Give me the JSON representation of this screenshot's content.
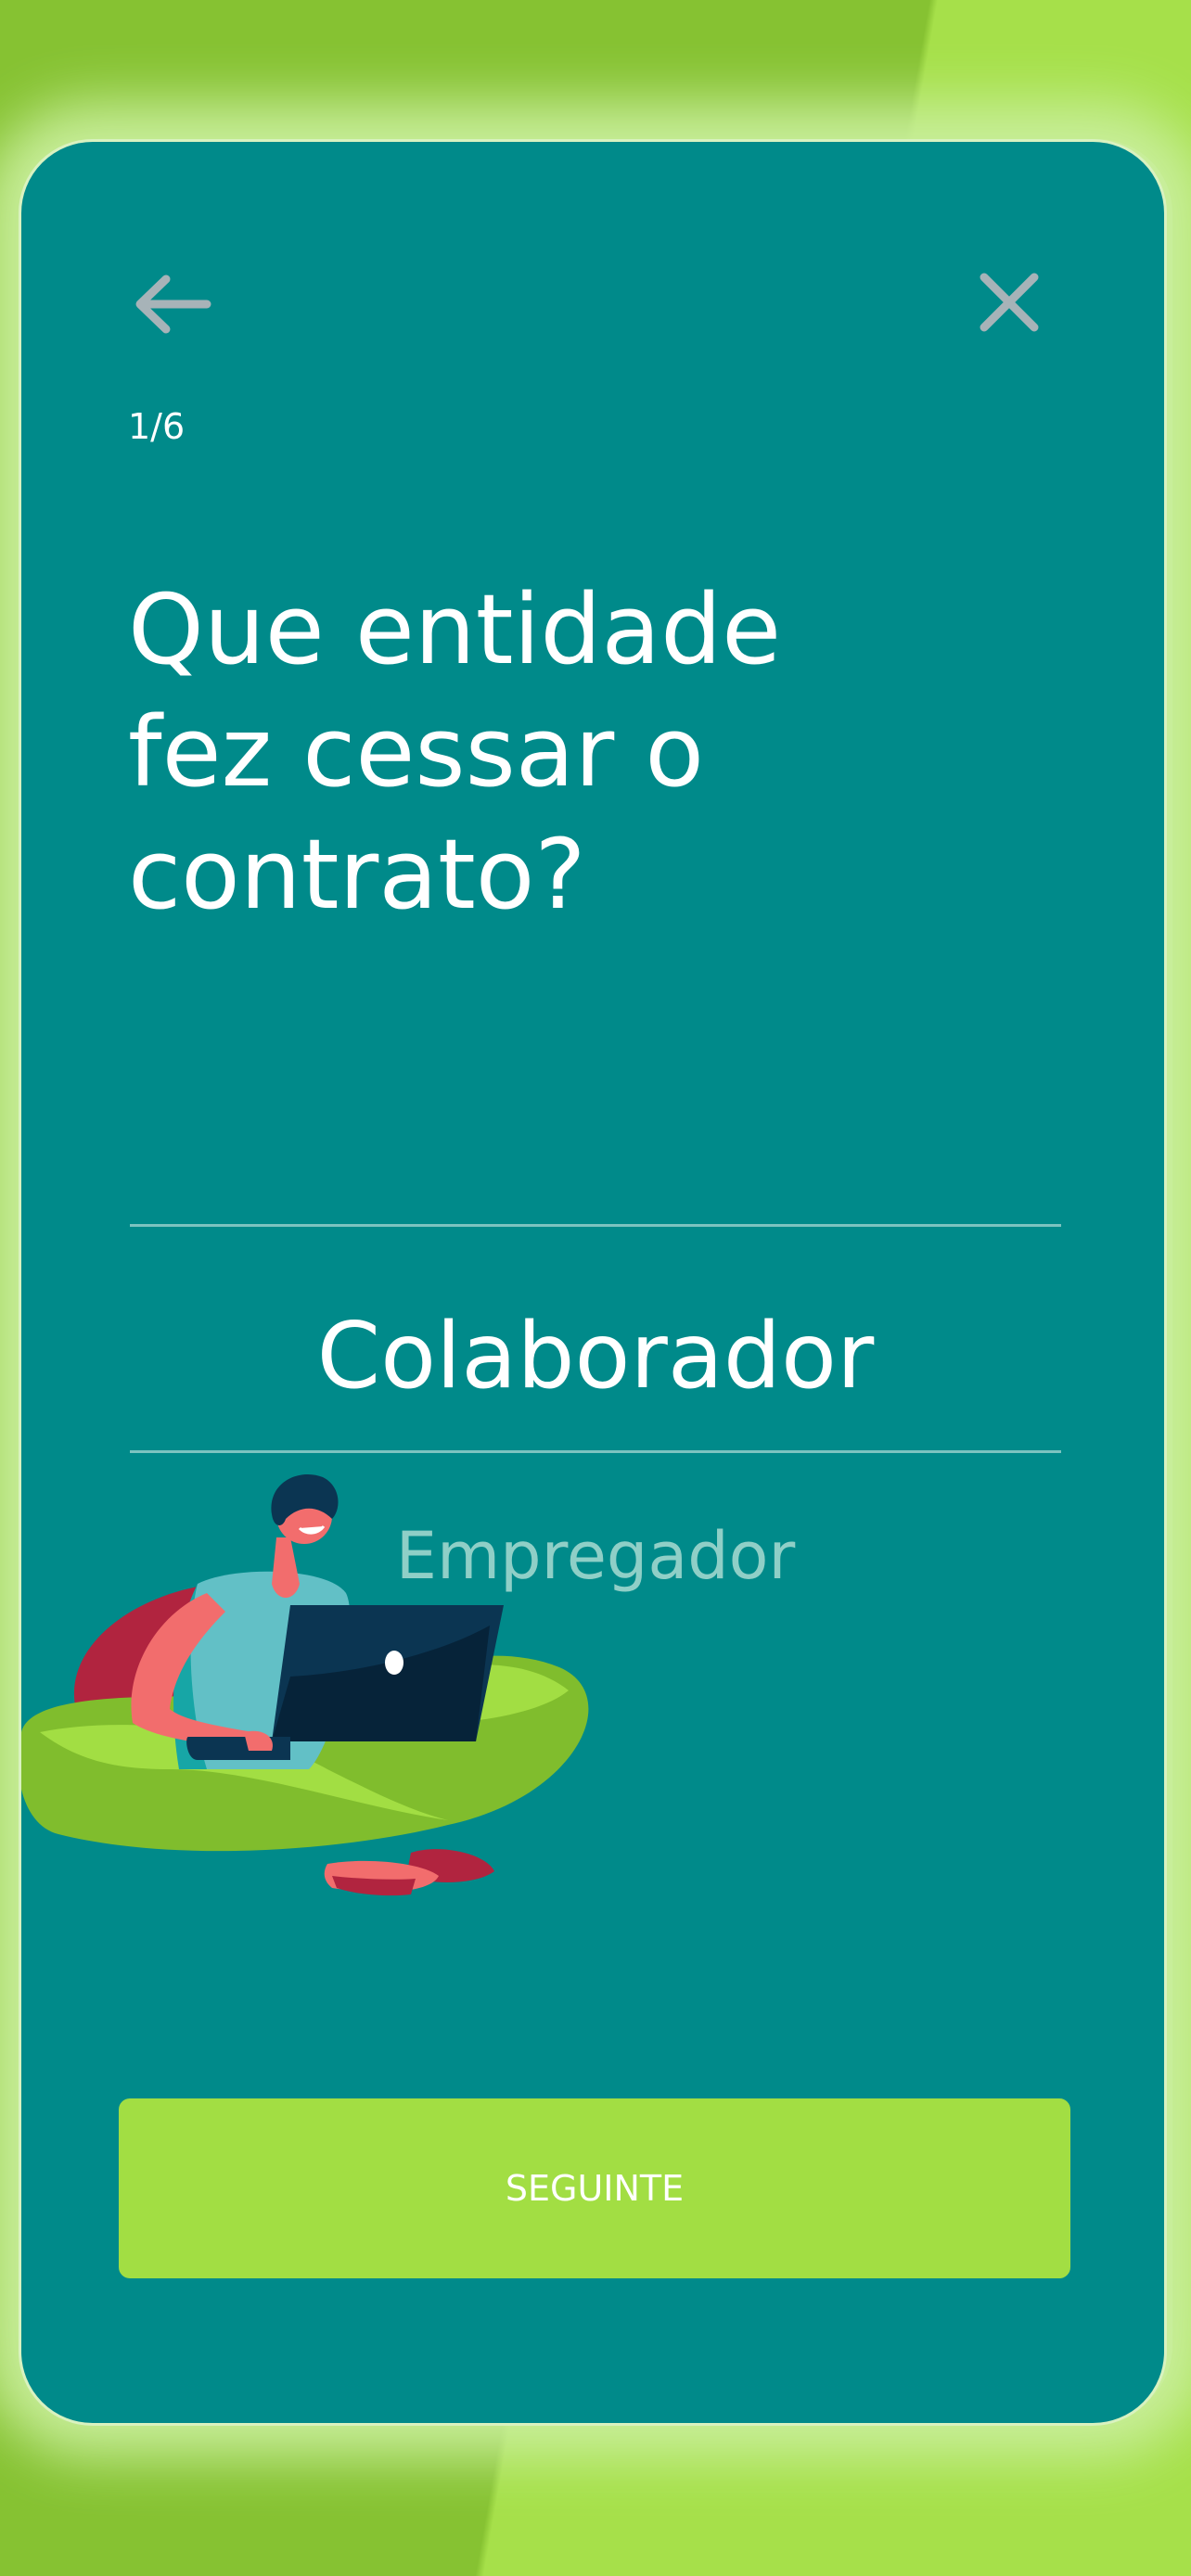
{
  "step": {
    "label": "1/6"
  },
  "question": {
    "line1": "Que entidade",
    "line2": "fez cessar o",
    "line3": "contrato?"
  },
  "picker": {
    "options": [
      "Colaborador",
      "Empregador"
    ],
    "selected": "Colaborador"
  },
  "actions": {
    "back_icon": "arrow-left-icon",
    "close_icon": "close-icon",
    "next_label": "SEGUINTE"
  },
  "colors": {
    "background": "#a2de43",
    "card": "#008a8a",
    "accent": "#a2de43",
    "text": "#ffffff",
    "muted_text": "#8fcfc7",
    "icon": "#a7b3b8"
  }
}
